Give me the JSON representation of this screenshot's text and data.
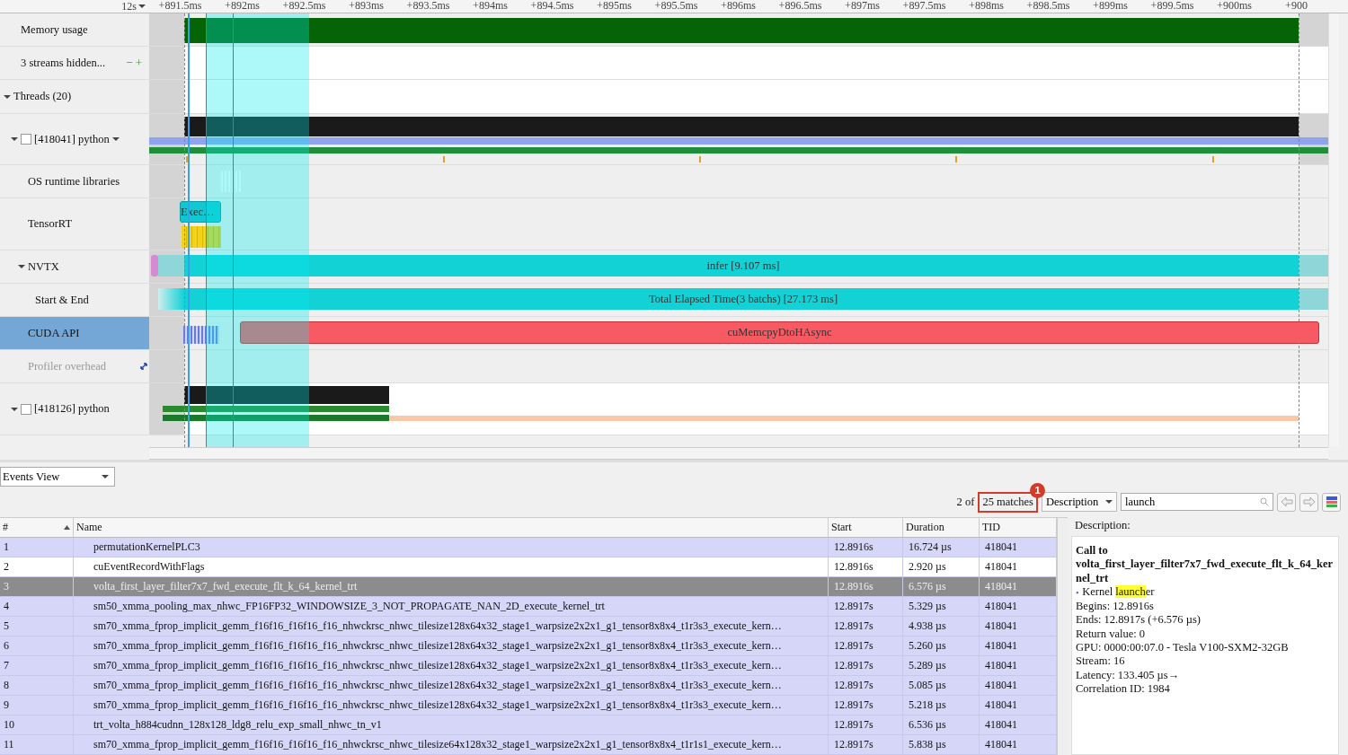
{
  "ruler": {
    "zoom": "12s",
    "ticks": [
      "+891.5ms",
      "+892ms",
      "+892.5ms",
      "+893ms",
      "+893.5ms",
      "+894ms",
      "+894.5ms",
      "+895ms",
      "+895.5ms",
      "+896ms",
      "+896.5ms",
      "+897ms",
      "+897.5ms",
      "+898ms",
      "+898.5ms",
      "+899ms",
      "+899.5ms",
      "+900ms",
      "+900"
    ]
  },
  "timeline": {
    "rows": [
      {
        "kind": "memory",
        "label": "Memory usage",
        "selected": false
      },
      {
        "kind": "hidden",
        "label": "3 streams hidden...",
        "remove": "−",
        "add": "+",
        "selected": false
      },
      {
        "kind": "group",
        "label": "Threads (20)",
        "expanded": true,
        "selected": false,
        "children": [
          {
            "kind": "process",
            "label": "[418041] python",
            "expanded": true,
            "checked": false,
            "menu": true,
            "selected": false,
            "children": [
              {
                "kind": "lib",
                "label": "OS runtime libraries",
                "selected": false
              },
              {
                "kind": "tensorrt",
                "label": "TensorRT",
                "bar": "Exec…",
                "selected": false
              },
              {
                "kind": "nvtx",
                "label": "NVTX",
                "expanded": true,
                "bar": "infer [9.107 ms]",
                "selected": false,
                "children": [
                  {
                    "kind": "range",
                    "label": "Start & End",
                    "bar": "Total Elapsed Time(3 batchs) [27.173 ms]",
                    "selected": false
                  }
                ]
              },
              {
                "kind": "cuda",
                "label": "CUDA API",
                "bar": "cuMemcpyDtoHAsync",
                "selected": true
              },
              {
                "kind": "overhead",
                "label": "Profiler overhead",
                "disabled": true,
                "selected": false
              }
            ]
          },
          {
            "kind": "process2",
            "label": "[418126] python",
            "expanded": true,
            "checked": false,
            "menu": false,
            "selected": false
          }
        ]
      }
    ]
  },
  "events": {
    "view": "Events View",
    "search": {
      "count": "2 of",
      "total": "25 matches",
      "badge": "1",
      "field": "Description",
      "value": "launch"
    },
    "columns": [
      "#",
      "Name",
      "Start",
      "Duration",
      "TID"
    ],
    "rows": [
      {
        "num": "1",
        "name": "permutationKernelPLC3",
        "start": "12.8916s",
        "duration": "16.724 µs",
        "tid": "418041",
        "matched": true,
        "selected": false
      },
      {
        "num": "2",
        "name": "cuEventRecordWithFlags",
        "start": "12.8916s",
        "duration": "2.920 µs",
        "tid": "418041",
        "matched": false,
        "selected": false
      },
      {
        "num": "3",
        "name": "volta_first_layer_filter7x7_fwd_execute_flt_k_64_kernel_trt",
        "start": "12.8916s",
        "duration": "6.576 µs",
        "tid": "418041",
        "matched": true,
        "selected": true
      },
      {
        "num": "4",
        "name": "sm50_xmma_pooling_max_nhwc_FP16FP32_WINDOWSIZE_3_NOT_PROPAGATE_NAN_2D_execute_kernel_trt",
        "start": "12.8917s",
        "duration": "5.329 µs",
        "tid": "418041",
        "matched": true,
        "selected": false
      },
      {
        "num": "5",
        "name": "sm70_xmma_fprop_implicit_gemm_f16f16_f16f16_f16_nhwckrsc_nhwc_tilesize128x64x32_stage1_warpsize2x2x1_g1_tensor8x8x4_t1r3s3_execute_kern…",
        "start": "12.8917s",
        "duration": "4.938 µs",
        "tid": "418041",
        "matched": true,
        "selected": false
      },
      {
        "num": "6",
        "name": "sm70_xmma_fprop_implicit_gemm_f16f16_f16f16_f16_nhwckrsc_nhwc_tilesize128x64x32_stage1_warpsize2x2x1_g1_tensor8x8x4_t1r3s3_execute_kern…",
        "start": "12.8917s",
        "duration": "5.260 µs",
        "tid": "418041",
        "matched": true,
        "selected": false
      },
      {
        "num": "7",
        "name": "sm70_xmma_fprop_implicit_gemm_f16f16_f16f16_f16_nhwckrsc_nhwc_tilesize128x64x32_stage1_warpsize2x2x1_g1_tensor8x8x4_t1r3s3_execute_kern…",
        "start": "12.8917s",
        "duration": "5.289 µs",
        "tid": "418041",
        "matched": true,
        "selected": false
      },
      {
        "num": "8",
        "name": "sm70_xmma_fprop_implicit_gemm_f16f16_f16f16_f16_nhwckrsc_nhwc_tilesize128x64x32_stage1_warpsize2x2x1_g1_tensor8x8x4_t1r3s3_execute_kern…",
        "start": "12.8917s",
        "duration": "5.085 µs",
        "tid": "418041",
        "matched": true,
        "selected": false
      },
      {
        "num": "9",
        "name": "sm70_xmma_fprop_implicit_gemm_f16f16_f16f16_f16_nhwckrsc_nhwc_tilesize128x64x32_stage1_warpsize2x2x1_g1_tensor8x8x4_t1r3s3_execute_kern…",
        "start": "12.8917s",
        "duration": "5.218 µs",
        "tid": "418041",
        "matched": true,
        "selected": false
      },
      {
        "num": "10",
        "name": "trt_volta_h884cudnn_128x128_ldg8_relu_exp_small_nhwc_tn_v1",
        "start": "12.8917s",
        "duration": "6.536 µs",
        "tid": "418041",
        "matched": true,
        "selected": false
      },
      {
        "num": "11",
        "name": "sm70_xmma_fprop_implicit_gemm_f16f16_f16f16_f16_nhwckrsc_nhwc_tilesize64x128x32_stage1_warpsize2x2x1_g1_tensor8x8x4_t1r1s1_execute_kern…",
        "start": "12.8917s",
        "duration": "5.838 µs",
        "tid": "418041",
        "matched": true,
        "selected": false
      }
    ]
  },
  "description": {
    "title": "Description:",
    "call": "Call to",
    "function": "volta_first_layer_filter7x7_fwd_execute_flt_k_64_kernel_trt",
    "kernel": {
      "bullet": "▪",
      "prefix": "Kernel ",
      "match": "launch",
      "suffix": "er"
    },
    "lines": [
      "Begins: 12.8916s",
      "Ends: 12.8917s (+6.576 µs)",
      "Return value: 0",
      "GPU: 0000:00:07.0 - Tesla V100-SXM2-32GB",
      "Stream: 16",
      "Latency: 133.405 µs→",
      "Correlation ID: 1984"
    ]
  }
}
